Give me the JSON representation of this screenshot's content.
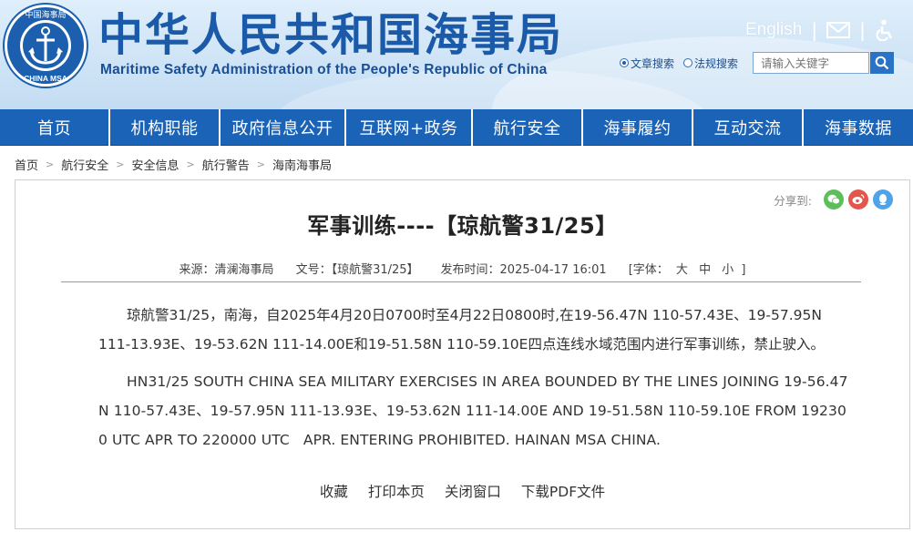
{
  "header": {
    "logo_text_top": "中国海事局",
    "logo_text_bottom": "CHINA MSA",
    "title": "中华人民共和国海事局",
    "subtitle": "Maritime Safety Administration of the People's Republic of China",
    "english_link": "English",
    "search": {
      "options": [
        {
          "label": "文章搜索",
          "selected": true
        },
        {
          "label": "法规搜索",
          "selected": false
        }
      ],
      "placeholder": "请输入关键字"
    }
  },
  "nav": {
    "items": [
      {
        "label": "首页"
      },
      {
        "label": "机构职能"
      },
      {
        "label": "政府信息公开"
      },
      {
        "label": "互联网+政务"
      },
      {
        "label": "航行安全"
      },
      {
        "label": "海事履约"
      },
      {
        "label": "互动交流"
      },
      {
        "label": "海事数据"
      }
    ]
  },
  "breadcrumb": [
    "首页",
    "航行安全",
    "安全信息",
    "航行警告",
    "海南海事局"
  ],
  "article": {
    "share_label": "分享到:",
    "title": "军事训练----【琼航警31/25】",
    "meta": {
      "source": "来源：清澜海事局",
      "doc_no": "文号：【琼航警31/25】",
      "published": "发布时间：2025-04-17 16:01",
      "font_label": "[字体：",
      "font_sizes": [
        "大",
        "中",
        "小"
      ],
      "font_end": "]"
    },
    "paragraph_cn": "琼航警31/25，南海，自2025年4月20日0700时至4月22日0800时,在19-56.47N 110-57.43E、19-57.95N 111-13.93E、19-53.62N 111-14.00E和19-51.58N 110-59.10E四点连线水域范围内进行军事训练，禁止驶入。",
    "paragraph_en": "HN31/25 SOUTH CHINA SEA MILITARY EXERCISES IN AREA BOUNDED BY THE LINES JOINING 19-56.47N 110-57.43E、19-57.95N 111-13.93E、19-53.62N 111-14.00E AND 19-51.58N 110-59.10E FROM 192300 UTC APR TO 220000 UTC   APR. ENTERING PROHIBITED. HAINAN MSA CHINA.",
    "actions": [
      "收藏",
      "打印本页",
      "关闭窗口",
      "下载PDF文件"
    ]
  },
  "colors": {
    "nav_bg": "#1b63b6",
    "title_blue": "#1a5aa8",
    "wechat": "#5cbf5a",
    "weibo": "#e2564b",
    "qq": "#4fa3e8"
  }
}
